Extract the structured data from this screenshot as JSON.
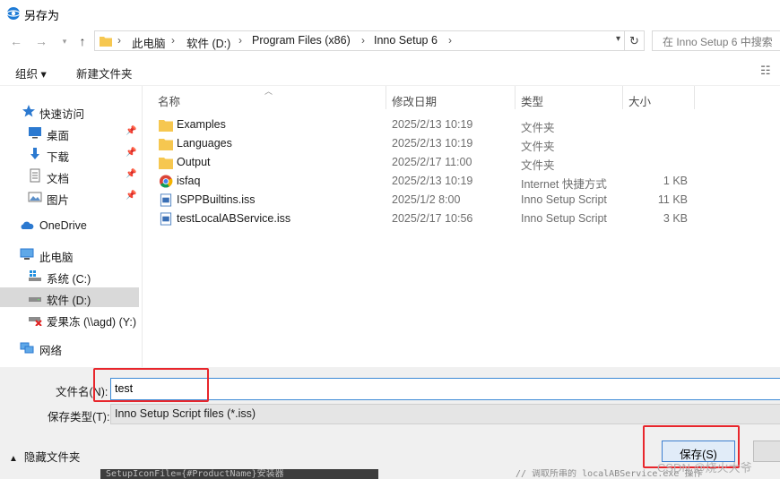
{
  "window": {
    "title": "另存为"
  },
  "address": {
    "breadcrumbs": [
      "此电脑",
      "软件 (D:)",
      "Program Files (x86)",
      "Inno Setup 6"
    ],
    "search_placeholder": "在 Inno Setup 6 中搜索"
  },
  "toolbar": {
    "organize": "组织 ▾",
    "new_folder": "新建文件夹"
  },
  "sidebar": {
    "items": [
      {
        "label": "快速访问",
        "icon": "star-icon"
      },
      {
        "label": "桌面",
        "icon": "desktop-icon",
        "pinned": true
      },
      {
        "label": "下载",
        "icon": "download-icon",
        "pinned": true
      },
      {
        "label": "文档",
        "icon": "document-icon",
        "pinned": true
      },
      {
        "label": "图片",
        "icon": "pictures-icon",
        "pinned": true
      },
      {
        "label": "OneDrive",
        "icon": "cloud-icon"
      },
      {
        "label": "此电脑",
        "icon": "computer-icon"
      },
      {
        "label": "系统 (C:)",
        "icon": "drive-c-icon"
      },
      {
        "label": "软件 (D:)",
        "icon": "drive-d-icon",
        "selected": true
      },
      {
        "label": "爱果冻 (\\\\agd) (Y:)",
        "icon": "network-drive-icon"
      },
      {
        "label": "网络",
        "icon": "network-icon"
      }
    ]
  },
  "columns": {
    "name": "名称",
    "date": "修改日期",
    "type": "类型",
    "size": "大小"
  },
  "files": [
    {
      "name": "Examples",
      "date": "2025/2/13 10:19",
      "type": "文件夹",
      "size": "",
      "icon": "folder-icon"
    },
    {
      "name": "Languages",
      "date": "2025/2/13 10:19",
      "type": "文件夹",
      "size": "",
      "icon": "folder-icon"
    },
    {
      "name": "Output",
      "date": "2025/2/17 11:00",
      "type": "文件夹",
      "size": "",
      "icon": "folder-icon"
    },
    {
      "name": "isfaq",
      "date": "2025/2/13 10:19",
      "type": "Internet 快捷方式",
      "size": "1 KB",
      "icon": "chrome-icon"
    },
    {
      "name": "ISPPBuiltins.iss",
      "date": "2025/1/2 8:00",
      "type": "Inno Setup Script",
      "size": "11 KB",
      "icon": "iss-file-icon"
    },
    {
      "name": "testLocalABService.iss",
      "date": "2025/2/17 10:56",
      "type": "Inno Setup Script",
      "size": "3 KB",
      "icon": "iss-file-icon"
    }
  ],
  "form": {
    "filename_label": "文件名(N):",
    "filename_value": "test",
    "filetype_label": "保存类型(T):",
    "filetype_value": "Inno Setup Script files (*.iss)",
    "hide_folders": "隐藏文件夹",
    "save_button": "保存(S)"
  },
  "background": {
    "code_left": "SetupIconFile={#ProductName}安装器",
    "code_right": "// 调取所串的 localABService.exe 操作"
  },
  "watermark": "CSDN @烧火大爷",
  "colors": {
    "accent": "#3c8ad6",
    "highlight_box": "#e8262c",
    "folder": "#f6c750"
  }
}
